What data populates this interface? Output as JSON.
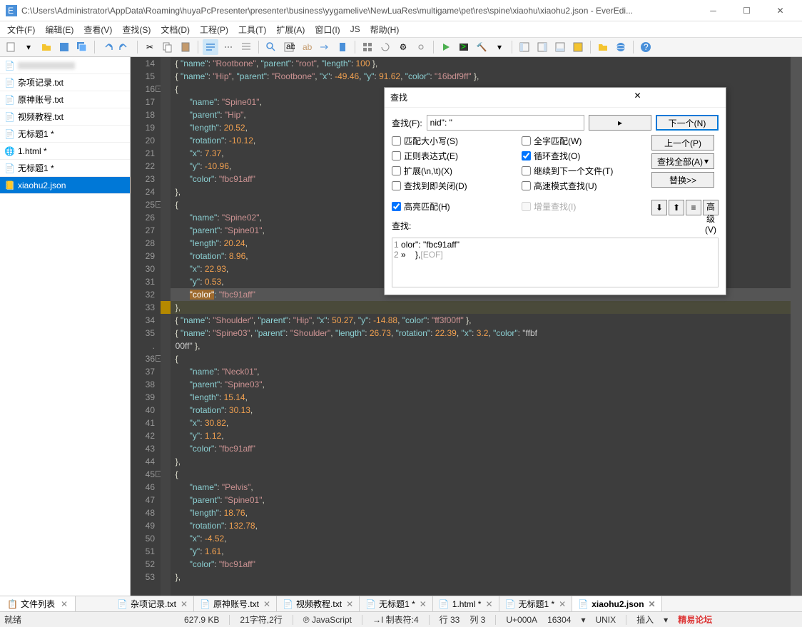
{
  "window": {
    "title": "C:\\Users\\Administrator\\AppData\\Roaming\\huyaPcPresenter\\presenter\\business\\yygamelive\\NewLuaRes\\multigame\\pet\\res\\spine\\xiaohu\\xiaohu2.json - EverEdi..."
  },
  "menu": {
    "items": [
      "文件(F)",
      "编辑(E)",
      "查看(V)",
      "查找(S)",
      "文档(D)",
      "工程(P)",
      "工具(T)",
      "扩展(A)",
      "窗口(I)",
      "JS",
      "帮助(H)"
    ]
  },
  "sidebar": {
    "files": [
      {
        "name": "",
        "icon": "blur"
      },
      {
        "name": "杂项记录.txt",
        "icon": "txt"
      },
      {
        "name": "原神账号.txt",
        "icon": "txt"
      },
      {
        "name": "视频教程.txt",
        "icon": "txt"
      },
      {
        "name": "无标题1 *",
        "icon": "txt"
      },
      {
        "name": "1.html *",
        "icon": "html"
      },
      {
        "name": "无标题1 *",
        "icon": "txt"
      },
      {
        "name": "xiaohu2.json",
        "icon": "json",
        "active": true
      }
    ]
  },
  "code_lines": [
    {
      "n": 14,
      "t": "{ \"name\": \"Rootbone\", \"parent\": \"root\", \"length\": 100 },"
    },
    {
      "n": 15,
      "t": "{ \"name\": \"Hip\", \"parent\": \"Rootbone\", \"x\": -49.46, \"y\": 91.62, \"color\": \"16bdf9ff\" },"
    },
    {
      "n": 16,
      "t": "{",
      "fold": true
    },
    {
      "n": 17,
      "t": "    \"name\": \"Spine01\","
    },
    {
      "n": 18,
      "t": "    \"parent\": \"Hip\","
    },
    {
      "n": 19,
      "t": "    \"length\": 20.52,"
    },
    {
      "n": 20,
      "t": "    \"rotation\": -10.12,"
    },
    {
      "n": 21,
      "t": "    \"x\": 7.37,"
    },
    {
      "n": 22,
      "t": "    \"y\": -10.96,"
    },
    {
      "n": 23,
      "t": "    \"color\": \"fbc91aff\""
    },
    {
      "n": 24,
      "t": "},"
    },
    {
      "n": 25,
      "t": "{",
      "fold": true
    },
    {
      "n": 26,
      "t": "    \"name\": \"Spine02\","
    },
    {
      "n": 27,
      "t": "    \"parent\": \"Spine01\","
    },
    {
      "n": 28,
      "t": "    \"length\": 20.24,"
    },
    {
      "n": 29,
      "t": "    \"rotation\": 8.96,"
    },
    {
      "n": 30,
      "t": "    \"x\": 22.93,"
    },
    {
      "n": 31,
      "t": "    \"y\": 0.53,"
    },
    {
      "n": 32,
      "t": "    \"color\": \"fbc91aff\"",
      "sel": true
    },
    {
      "n": 33,
      "t": "},",
      "cursor": true
    },
    {
      "n": 34,
      "t": "{ \"name\": \"Shoulder\", \"parent\": \"Hip\", \"x\": 50.27, \"y\": -14.88, \"color\": \"ff3f00ff\" },"
    },
    {
      "n": 35,
      "t": "{ \"name\": \"Spine03\", \"parent\": \"Shoulder\", \"length\": 26.73, \"rotation\": 22.39, \"x\": 3.2, \"color\": \"ffbf"
    },
    {
      "n": ".",
      "t": "00ff\" },"
    },
    {
      "n": 36,
      "t": "{",
      "fold": true
    },
    {
      "n": 37,
      "t": "    \"name\": \"Neck01\","
    },
    {
      "n": 38,
      "t": "    \"parent\": \"Spine03\","
    },
    {
      "n": 39,
      "t": "    \"length\": 15.14,"
    },
    {
      "n": 40,
      "t": "    \"rotation\": 30.13,"
    },
    {
      "n": 41,
      "t": "    \"x\": 30.82,"
    },
    {
      "n": 42,
      "t": "    \"y\": 1.12,"
    },
    {
      "n": 43,
      "t": "    \"color\": \"fbc91aff\""
    },
    {
      "n": 44,
      "t": "},"
    },
    {
      "n": 45,
      "t": "{",
      "fold": true
    },
    {
      "n": 46,
      "t": "    \"name\": \"Pelvis\","
    },
    {
      "n": 47,
      "t": "    \"parent\": \"Spine01\","
    },
    {
      "n": 48,
      "t": "    \"length\": 18.76,"
    },
    {
      "n": 49,
      "t": "    \"rotation\": 132.78,"
    },
    {
      "n": 50,
      "t": "    \"x\": -4.52,"
    },
    {
      "n": 51,
      "t": "    \"y\": 1.61,"
    },
    {
      "n": 52,
      "t": "    \"color\": \"fbc91aff\""
    },
    {
      "n": 53,
      "t": "},"
    }
  ],
  "find": {
    "title": "查找",
    "label_find": "查找(F):",
    "input": "nid\": \"",
    "btn_next": "下一个(N)",
    "btn_prev": "上一个(P)",
    "btn_all": "查找全部(A)",
    "btn_replace": "替换>>",
    "chk_case": "匹配大小写(S)",
    "chk_regex": "正则表达式(E)",
    "chk_ext": "扩展(\\n,\\t)(X)",
    "chk_closeimm": "查找到即关闭(D)",
    "chk_hilite": "高亮匹配(H)",
    "chk_whole": "全字匹配(W)",
    "chk_loop": "循环查找(O)",
    "chk_continue": "继续到下一个文件(T)",
    "chk_fast": "高速模式查找(U)",
    "chk_incr": "增量查找(I)",
    "label_advanced": "高级(V)",
    "label_results": "查找:",
    "result1": "olor\": \"fbc91aff\"",
    "result2": "},",
    "result_eof": "[EOF]"
  },
  "bottom_panel": {
    "label": "文件列表"
  },
  "doc_tabs": [
    {
      "name": "杂项记录.txt"
    },
    {
      "name": "原神账号.txt"
    },
    {
      "name": "视频教程.txt"
    },
    {
      "name": "无标题1 *"
    },
    {
      "name": "1.html *"
    },
    {
      "name": "无标题1 *"
    },
    {
      "name": "xiaohu2.json",
      "active": true
    }
  ],
  "status": {
    "ready": "就绪",
    "size": "627.9 KB",
    "sel": "21字符,2行",
    "lang": "JavaScript",
    "tab": "制表符:4",
    "line": "行 33",
    "col": "列 3",
    "unicode": "U+000A",
    "codepage": "16304",
    "eol": "UNIX",
    "mode": "插入",
    "watermark": "精易论坛"
  }
}
